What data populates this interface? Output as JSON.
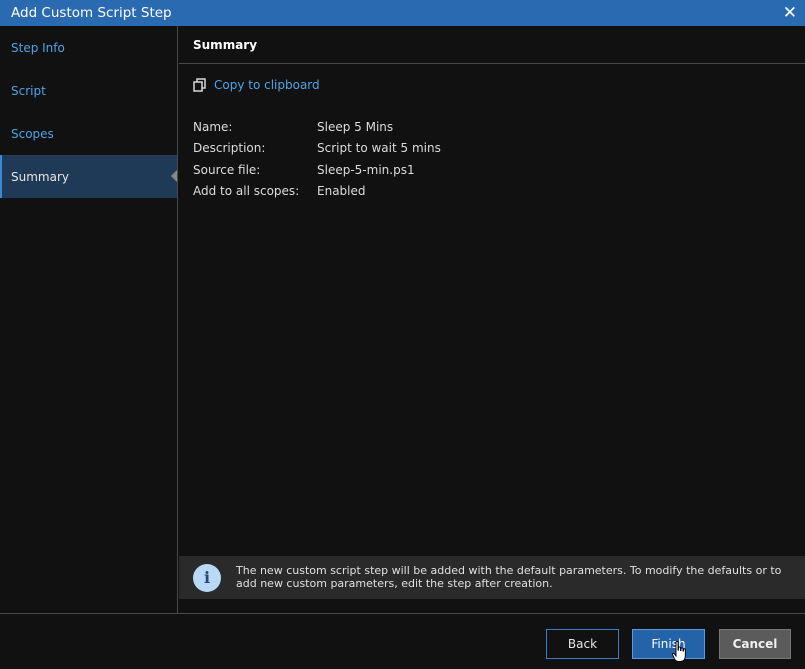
{
  "window": {
    "title": "Add Custom Script Step",
    "close_icon": "✕"
  },
  "sidebar": {
    "items": [
      {
        "label": "Step Info",
        "active": false
      },
      {
        "label": "Script",
        "active": false
      },
      {
        "label": "Scopes",
        "active": false
      },
      {
        "label": "Summary",
        "active": true
      }
    ]
  },
  "main": {
    "header": "Summary",
    "copy_link": "Copy to clipboard",
    "details": [
      {
        "label": "Name:",
        "value": "Sleep 5 Mins"
      },
      {
        "label": "Description:",
        "value": "Script to wait 5 mins"
      },
      {
        "label": "Source file:",
        "value": "Sleep-5-min.ps1"
      },
      {
        "label": "Add to all scopes:",
        "value": "Enabled"
      }
    ],
    "info_icon": "i",
    "info_text": "The new custom script step will be added with the default parameters. To modify the defaults or to add new custom parameters, edit the step after creation."
  },
  "footer": {
    "back_label": "Back",
    "finish_label": "Finish",
    "cancel_label": "Cancel"
  },
  "colors": {
    "titlebar": "#2a6ab0",
    "link": "#4da3e8",
    "active_nav": "#1e3a56",
    "finish_button": "#2563a8",
    "cancel_button": "#5b5b5b"
  }
}
